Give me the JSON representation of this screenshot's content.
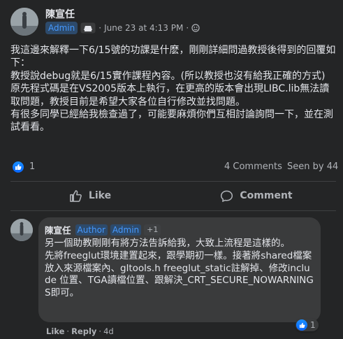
{
  "post": {
    "author": "陳宣任",
    "badge": "Admin",
    "date": "June 23 at 4:13 PM",
    "separator": "·",
    "body": [
      "我這邊來解釋一下6/15號的功課是什麽，剛剛詳細問過教授後得到的回覆如下：",
      "教授說debug就是6/15實作課程內容。(所以教授也沒有給我正確的方式)",
      "原先程式碼是在VS2005版本上執行，在更高的版本會出現LIBC.lib無法讀取問題，教授目前是希望大家各位自行修改並找問題。",
      "有很多同學已經給我檢查過了，可能要麻煩你們互相討論詢問一下，並在測試看看。"
    ],
    "reaction_count": "1",
    "comments_count": "4 Comments",
    "seen_by": "Seen by 44"
  },
  "actions": {
    "like_label": "Like",
    "comment_label": "Comment"
  },
  "comment": {
    "author": "陳宣任",
    "badge_author": "Author",
    "badge_admin": "Admin",
    "badge_more": "+1",
    "body": [
      "另一個助教剛剛有將方法告訴給我，大致上流程是這樣的。",
      "先將freeglut環境建置起來，跟學期初一樣。接著將shared檔案放入來源檔案內、gltools.h freeglut_static註解掉、修改include 位置、TGA讀檔位置、跟解決_CRT_SECURE_NOWARNINGS即可。"
    ],
    "like_label": "Like",
    "separator": "·",
    "reply_label": "Reply",
    "age": "4d",
    "reaction_count": "1"
  },
  "colors": {
    "background": "#242526",
    "bubble": "#3a3b3c",
    "accent": "#0866ff",
    "badge_text": "#4599ff",
    "secondary_text": "#b0b3b8"
  },
  "icons": {
    "privacy": "users-group-icon",
    "globe": "globe-icon",
    "like": "thumbs-up-icon",
    "comment": "speech-bubble-icon"
  }
}
